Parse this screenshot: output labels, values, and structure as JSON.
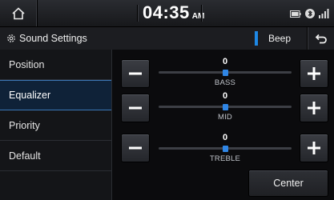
{
  "status": {
    "time": "04:35",
    "ampm": "AM",
    "icons": [
      "home-icon",
      "battery-icon",
      "bluetooth-phone-icon",
      "signal-icon"
    ]
  },
  "header": {
    "title": "Sound Settings",
    "title_icon": "gear-icon",
    "beep_label": "Beep",
    "beep_accent": "#1e88e5",
    "back_icon": "back-arrow-icon"
  },
  "sidebar": {
    "items": [
      {
        "label": "Position",
        "active": false
      },
      {
        "label": "Equalizer",
        "active": true
      },
      {
        "label": "Priority",
        "active": false
      },
      {
        "label": "Default",
        "active": false
      }
    ]
  },
  "equalizer": {
    "bands": [
      {
        "label": "BASS",
        "value": "0",
        "level": 0.5
      },
      {
        "label": "MID",
        "value": "0",
        "level": 0.5
      },
      {
        "label": "TREBLE",
        "value": "0",
        "level": 0.5
      }
    ],
    "decrease_symbol": "minus-icon",
    "increase_symbol": "plus-icon",
    "center_label": "Center"
  },
  "colors": {
    "accent": "#2f86e6",
    "active_row": "#0f2238"
  }
}
